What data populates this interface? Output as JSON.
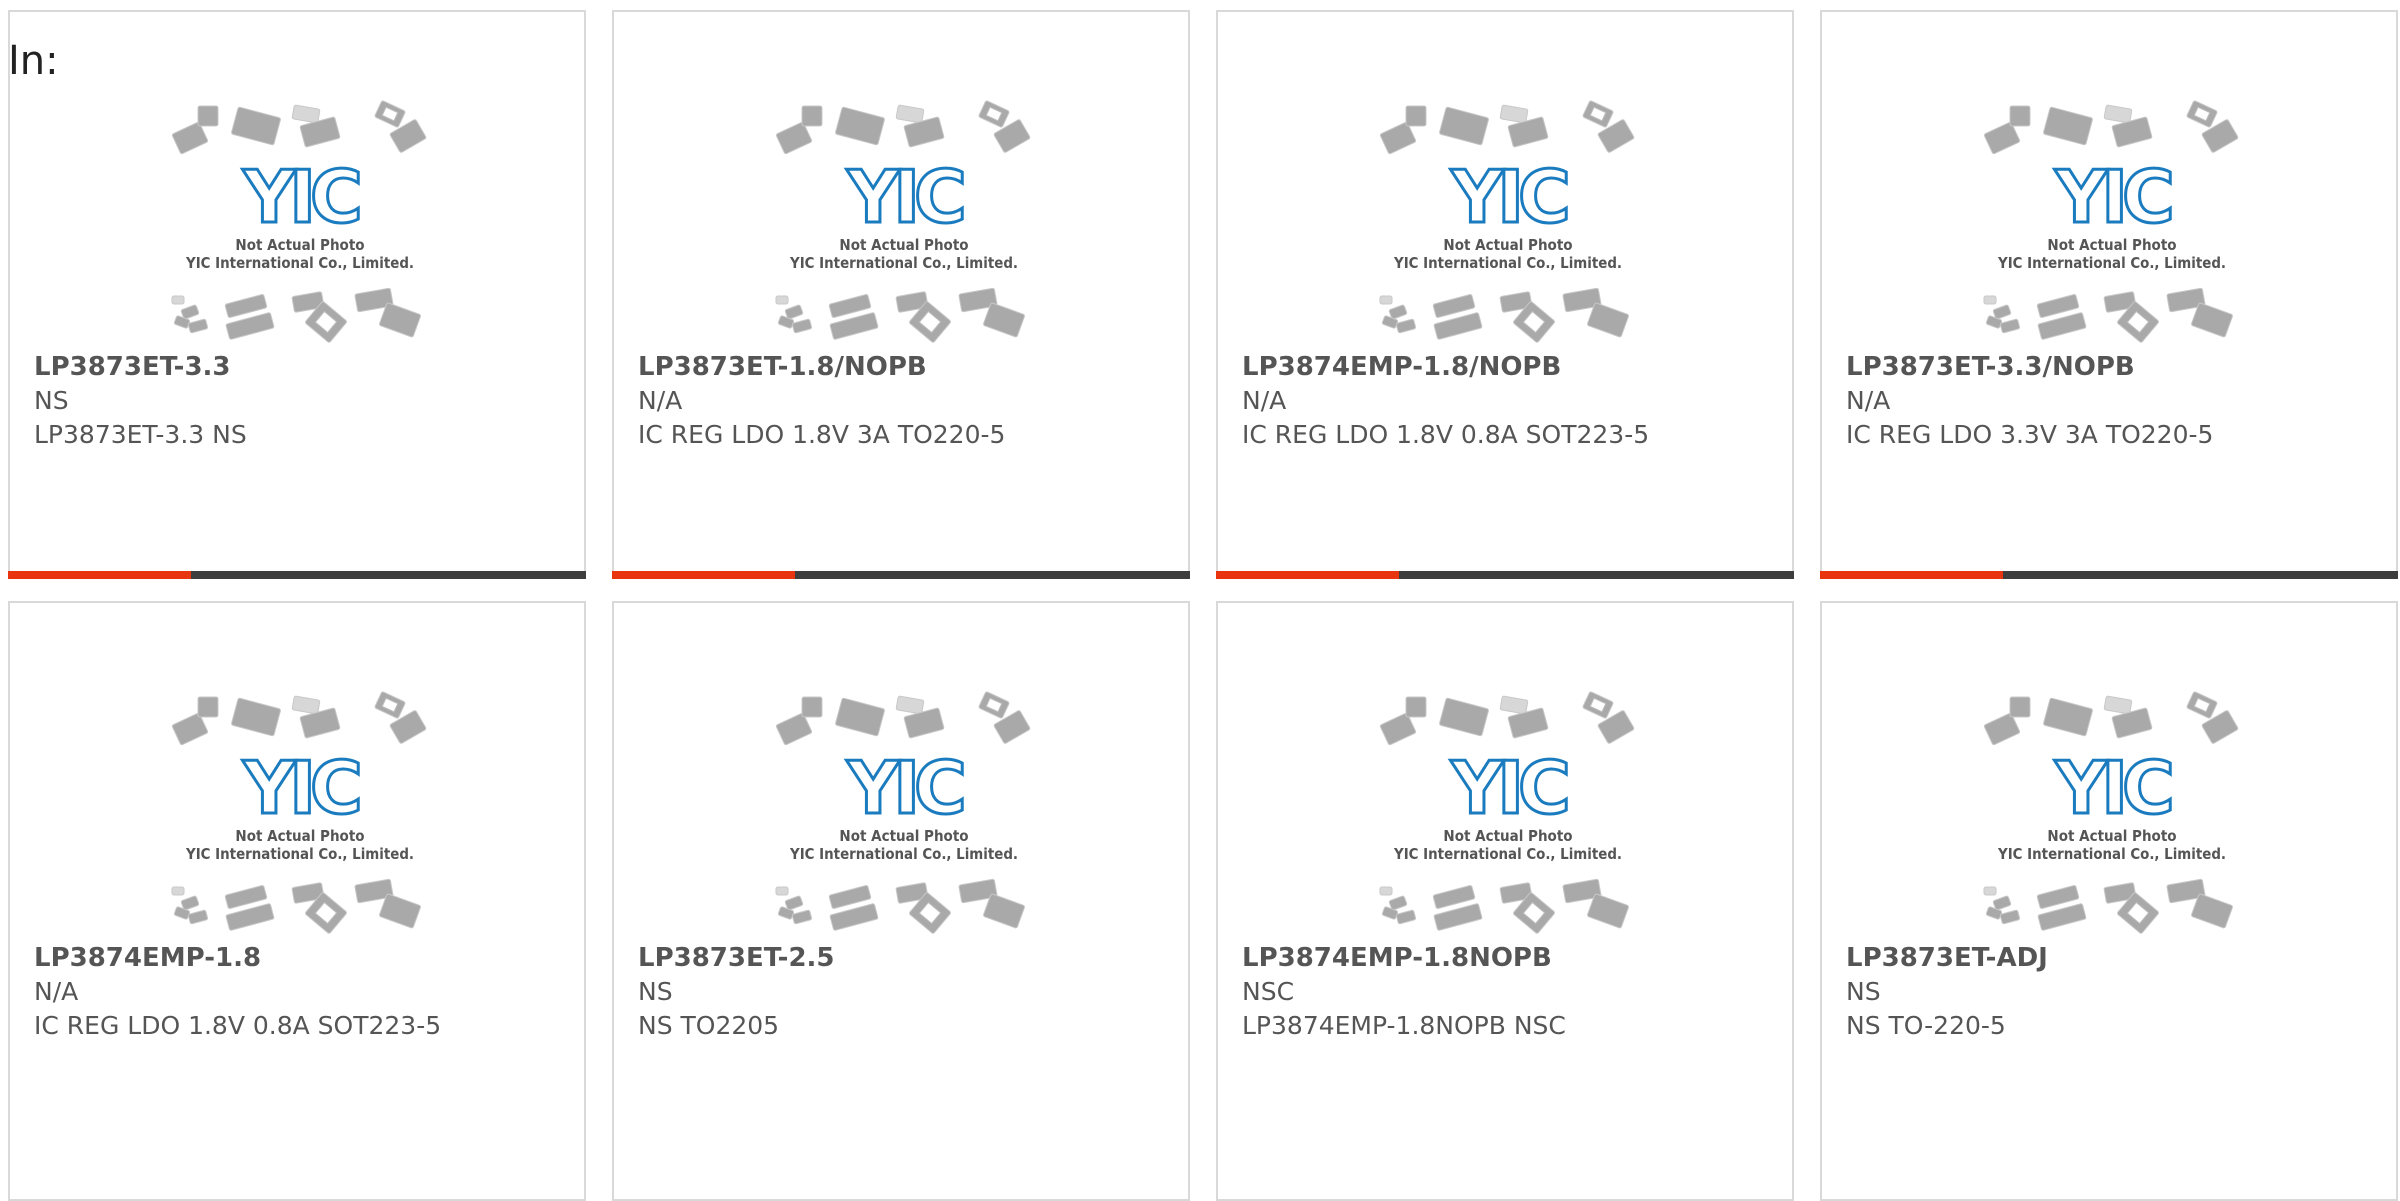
{
  "prefix_label": "In:",
  "colors": {
    "accent": "#e8350f",
    "bar": "#3d3d3d",
    "text": "#555555",
    "logo_blue": "#1a7bbf",
    "chip_gray": "#a9a9a9"
  },
  "placeholder": {
    "line1": "Not Actual Photo",
    "line2": "YIC International Co., Limited.",
    "logo": "YIC"
  },
  "products": [
    {
      "part": "LP3873ET-3.3",
      "manufacturer": "NS",
      "description": "LP3873ET-3.3 NS"
    },
    {
      "part": "LP3873ET-1.8/NOPB",
      "manufacturer": "N/A",
      "description": "IC REG LDO 1.8V 3A TO220-5"
    },
    {
      "part": "LP3874EMP-1.8/NOPB",
      "manufacturer": "N/A",
      "description": "IC REG LDO 1.8V 0.8A SOT223-5"
    },
    {
      "part": "LP3873ET-3.3/NOPB",
      "manufacturer": "N/A",
      "description": "IC REG LDO 3.3V 3A TO220-5"
    },
    {
      "part": "LP3874EMP-1.8",
      "manufacturer": "N/A",
      "description": "IC REG LDO 1.8V 0.8A SOT223-5"
    },
    {
      "part": "LP3873ET-2.5",
      "manufacturer": "NS",
      "description": "NS TO2205"
    },
    {
      "part": "LP3874EMP-1.8NOPB",
      "manufacturer": "NSC",
      "description": "LP3874EMP-1.8NOPB NSC"
    },
    {
      "part": "LP3873ET-ADJ",
      "manufacturer": "NS",
      "description": "NS TO-220-5"
    }
  ]
}
